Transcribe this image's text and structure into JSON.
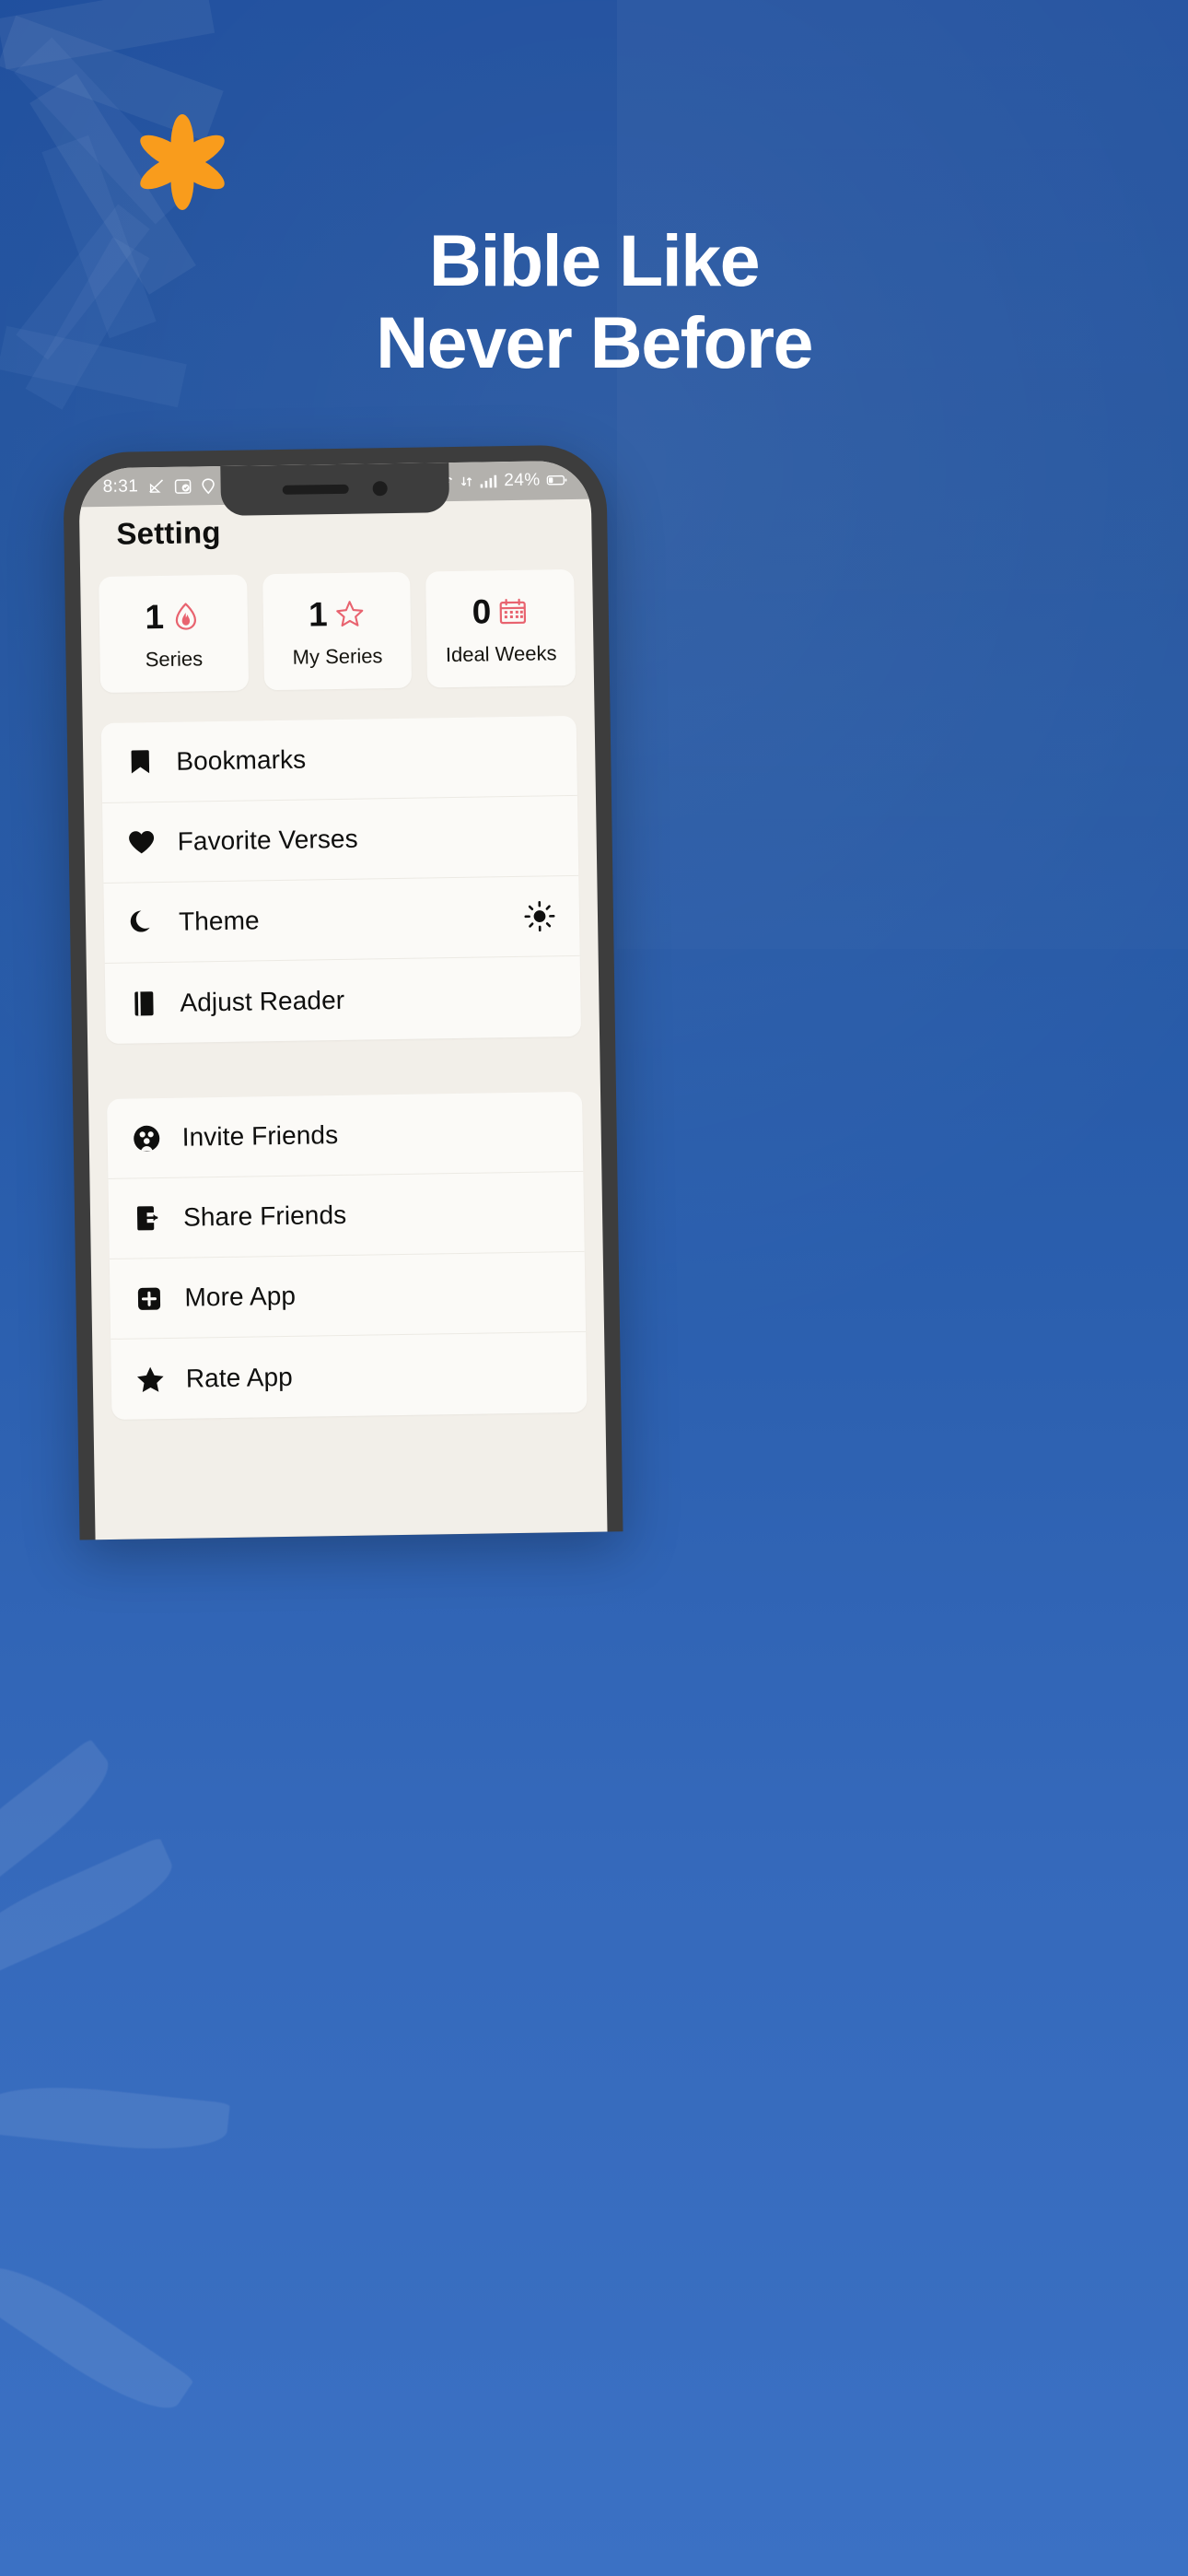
{
  "brand": {
    "logo_icon": "asterisk-flower-icon",
    "logo_color": "#F99C1C",
    "background_color": "#2a5cae"
  },
  "hero": {
    "headline_line1": "Bible Like",
    "headline_line2": "Never Before",
    "headline_color": "#FFFFFF"
  },
  "phone": {
    "status_bar": {
      "time": "8:31",
      "left_icons": [
        "signal-slash-icon",
        "screenshot-icon",
        "location-icon"
      ],
      "right_icons": [
        "wifi-icon",
        "data-transfer-icon",
        "cellular-bars-icon",
        "battery-icon"
      ],
      "battery_percent": "24%"
    },
    "screen": {
      "title": "Setting",
      "accent_color": "#E8636F",
      "stats": [
        {
          "value": "1",
          "label": "Series",
          "icon": "flame-icon"
        },
        {
          "value": "1",
          "label": "My Series",
          "icon": "star-outline-icon"
        },
        {
          "value": "0",
          "label": "Ideal Weeks",
          "icon": "calendar-icon"
        }
      ],
      "menu_groups": [
        {
          "items": [
            {
              "label": "Bookmarks",
              "icon": "bookmark-icon",
              "trailing_icon": null
            },
            {
              "label": "Favorite Verses",
              "icon": "heart-icon",
              "trailing_icon": null
            },
            {
              "label": "Theme",
              "icon": "moon-icon",
              "trailing_icon": "sun-icon"
            },
            {
              "label": "Adjust Reader",
              "icon": "book-cover-icon",
              "trailing_icon": null
            }
          ]
        },
        {
          "items": [
            {
              "label": "Invite Friends",
              "icon": "people-group-icon",
              "trailing_icon": null
            },
            {
              "label": "Share Friends",
              "icon": "share-phone-icon",
              "trailing_icon": null
            },
            {
              "label": "More App",
              "icon": "plus-square-icon",
              "trailing_icon": null
            },
            {
              "label": "Rate App",
              "icon": "star-filled-icon",
              "trailing_icon": null
            }
          ]
        }
      ]
    }
  }
}
